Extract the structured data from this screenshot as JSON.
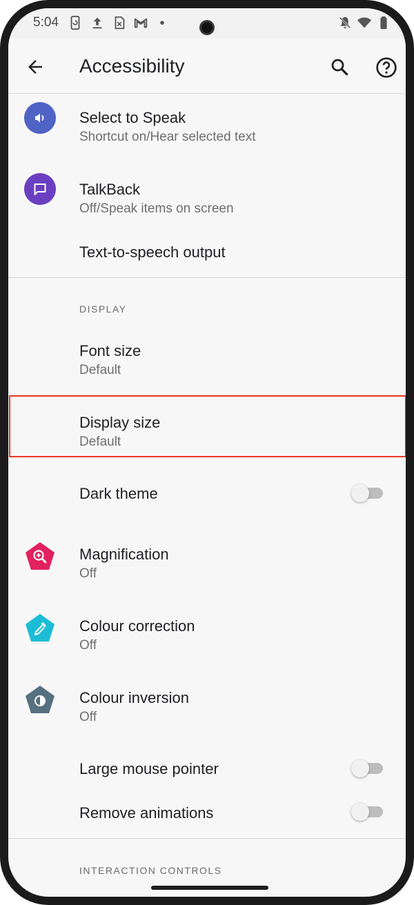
{
  "status_bar": {
    "time": "5:04",
    "left_icons": [
      "phone-sync-icon",
      "upload-icon",
      "sim-icon",
      "gmail-icon",
      "dot-icon"
    ],
    "right_icons": [
      "do-not-disturb-icon",
      "wifi-icon",
      "battery-icon"
    ]
  },
  "app_bar": {
    "title": "Accessibility",
    "back_icon": "arrow-back-icon",
    "search_icon": "search-icon",
    "help_icon": "help-icon"
  },
  "screen_reader_items": [
    {
      "title": "Select to Speak",
      "summary": "Shortcut on/Hear selected text",
      "icon": "select-to-speak-icon",
      "icon_color": "#4f63c4"
    },
    {
      "title": "TalkBack",
      "summary": "Off/Speak items on screen",
      "icon": "talkback-icon",
      "icon_color": "#6a3fc1"
    },
    {
      "title": "Text-to-speech output"
    }
  ],
  "display_section": {
    "header": "DISPLAY",
    "font_size": {
      "title": "Font size",
      "summary": "Default"
    },
    "display_size": {
      "title": "Display size",
      "summary": "Default"
    },
    "dark_theme": {
      "title": "Dark theme",
      "enabled": false
    },
    "magnification": {
      "title": "Magnification",
      "summary": "Off",
      "icon": "magnification-icon",
      "icon_color": "#e2215f"
    },
    "colour_correction": {
      "title": "Colour correction",
      "summary": "Off",
      "icon": "colour-correction-icon",
      "icon_color": "#1dbcd6"
    },
    "colour_inversion": {
      "title": "Colour inversion",
      "summary": "Off",
      "icon": "colour-inversion-icon",
      "icon_color": "#55707f"
    },
    "large_mouse_pointer": {
      "title": "Large mouse pointer",
      "enabled": false
    },
    "remove_animations": {
      "title": "Remove animations",
      "enabled": false
    }
  },
  "interaction_section": {
    "header": "INTERACTION CONTROLS"
  },
  "colors": {
    "highlight_border": "#e53a23",
    "background": "#f7f7f7",
    "primary_text": "#202124",
    "secondary_text": "#6e6e6e"
  }
}
